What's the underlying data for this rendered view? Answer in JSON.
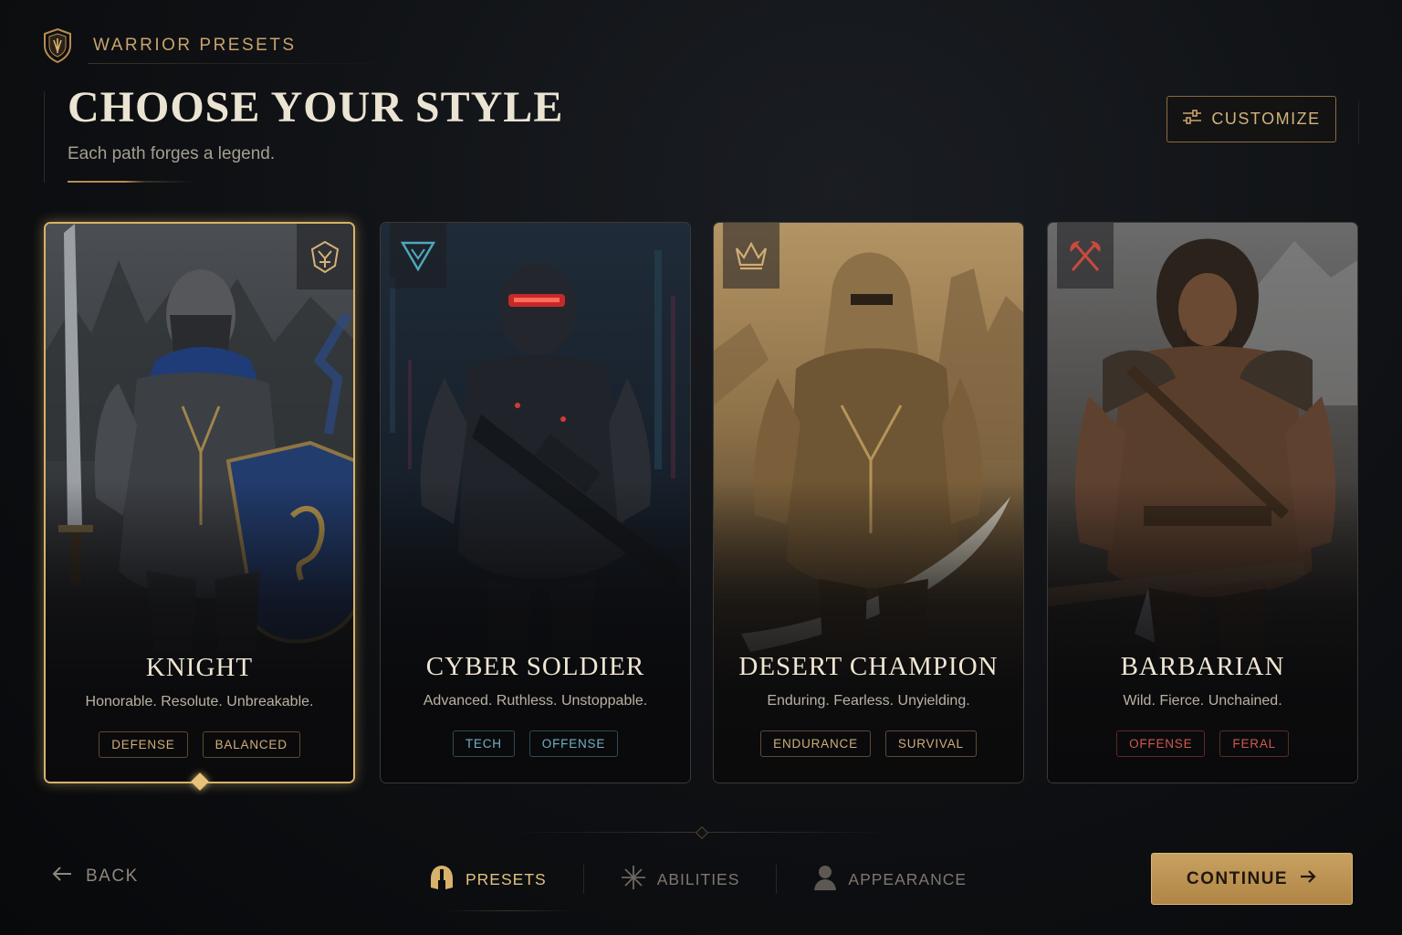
{
  "header": {
    "brand_label": "WARRIOR PRESETS",
    "brand_icon": "shield-crest-icon",
    "title": "CHOOSE YOUR STYLE",
    "subtitle": "Each path forges a legend.",
    "customize_label": "CUSTOMIZE"
  },
  "cards": [
    {
      "name": "KNIGHT",
      "description": "Honorable. Resolute. Unbreakable.",
      "tags": [
        "DEFENSE",
        "BALANCED"
      ],
      "crest_icon": "griffin-crest-icon",
      "accent": "#d8b26a",
      "selected": true
    },
    {
      "name": "CYBER SOLDIER",
      "description": "Advanced. Ruthless. Unstoppable.",
      "tags": [
        "TECH",
        "OFFENSE"
      ],
      "crest_icon": "triangle-crest-icon",
      "accent": "#4fa8bf",
      "selected": false
    },
    {
      "name": "DESERT CHAMPION",
      "description": "Enduring. Fearless. Unyielding.",
      "tags": [
        "ENDURANCE",
        "SURVIVAL"
      ],
      "crest_icon": "crown-crest-icon",
      "accent": "#d0ad74",
      "selected": false
    },
    {
      "name": "BARBARIAN",
      "description": "Wild. Fierce. Unchained.",
      "tags": [
        "OFFENSE",
        "FERAL"
      ],
      "crest_icon": "crossed-axes-icon",
      "accent": "#c94a3c",
      "selected": false
    }
  ],
  "footer": {
    "back_label": "BACK",
    "steps": [
      {
        "label": "PRESETS",
        "icon": "helmet-icon",
        "active": true
      },
      {
        "label": "ABILITIES",
        "icon": "starburst-icon",
        "active": false
      },
      {
        "label": "APPEARANCE",
        "icon": "person-icon",
        "active": false
      }
    ],
    "continue_label": "CONTINUE"
  }
}
